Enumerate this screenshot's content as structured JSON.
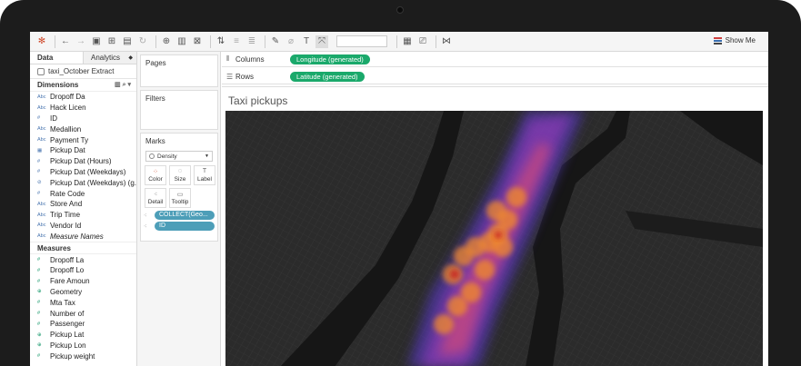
{
  "toolbar": {
    "show_me_label": "Show Me"
  },
  "data_pane": {
    "tabs": [
      {
        "label": "Data"
      },
      {
        "label": "Analytics"
      }
    ],
    "datasource": "taxi_October Extract",
    "dimensions_title": "Dimensions",
    "dimensions": [
      {
        "type": "Abc",
        "name": "Dropoff Da"
      },
      {
        "type": "Abc",
        "name": "Hack Licen"
      },
      {
        "type": "#",
        "name": "ID"
      },
      {
        "type": "Abc",
        "name": "Medallion"
      },
      {
        "type": "Abc",
        "name": "Payment Ty"
      },
      {
        "type": "cal",
        "name": "Pickup Dat"
      },
      {
        "type": "#",
        "name": "Pickup Dat (Hours)"
      },
      {
        "type": "#",
        "name": "Pickup Dat (Weekdays)"
      },
      {
        "type": "%",
        "name": "Pickup Dat (Weekdays) (g..."
      },
      {
        "type": "#",
        "name": "Rate Code"
      },
      {
        "type": "Abc",
        "name": "Store And"
      },
      {
        "type": "Abc",
        "name": "Trip Time"
      },
      {
        "type": "Abc",
        "name": "Vendor Id"
      },
      {
        "type": "Abc",
        "name": "Measure Names"
      }
    ],
    "measures_title": "Measures",
    "measures": [
      {
        "type": "#",
        "name": "Dropoff La"
      },
      {
        "type": "#",
        "name": "Dropoff Lo"
      },
      {
        "type": "#",
        "name": "Fare Amoun"
      },
      {
        "type": "globe",
        "name": "Geometry"
      },
      {
        "type": "#",
        "name": "Mta Tax"
      },
      {
        "type": "#",
        "name": "Number of"
      },
      {
        "type": "#",
        "name": "Passenger"
      },
      {
        "type": "globe",
        "name": "Pickup Lat"
      },
      {
        "type": "globe",
        "name": "Pickup Lon"
      },
      {
        "type": "#",
        "name": "Pickup weight"
      }
    ]
  },
  "cards": {
    "pages_title": "Pages",
    "filters_title": "Filters",
    "marks_title": "Marks",
    "mark_type": "Density",
    "mark_buttons": [
      {
        "label": "Color"
      },
      {
        "label": "Size"
      },
      {
        "label": "Label"
      },
      {
        "label": "Detail"
      },
      {
        "label": "Tooltip"
      }
    ],
    "mark_pills": [
      {
        "label": "COLLECT(Geo..."
      },
      {
        "label": "ID"
      }
    ]
  },
  "shelves": {
    "columns_label": "Columns",
    "columns_pill": "Longitude (generated)",
    "rows_label": "Rows",
    "rows_pill": "Latitude (generated)"
  },
  "view": {
    "title": "Taxi pickups"
  },
  "colors": {
    "pill_green": "#1aa96b",
    "pill_blue": "#4d9eb8",
    "map_bg": "#202020"
  }
}
